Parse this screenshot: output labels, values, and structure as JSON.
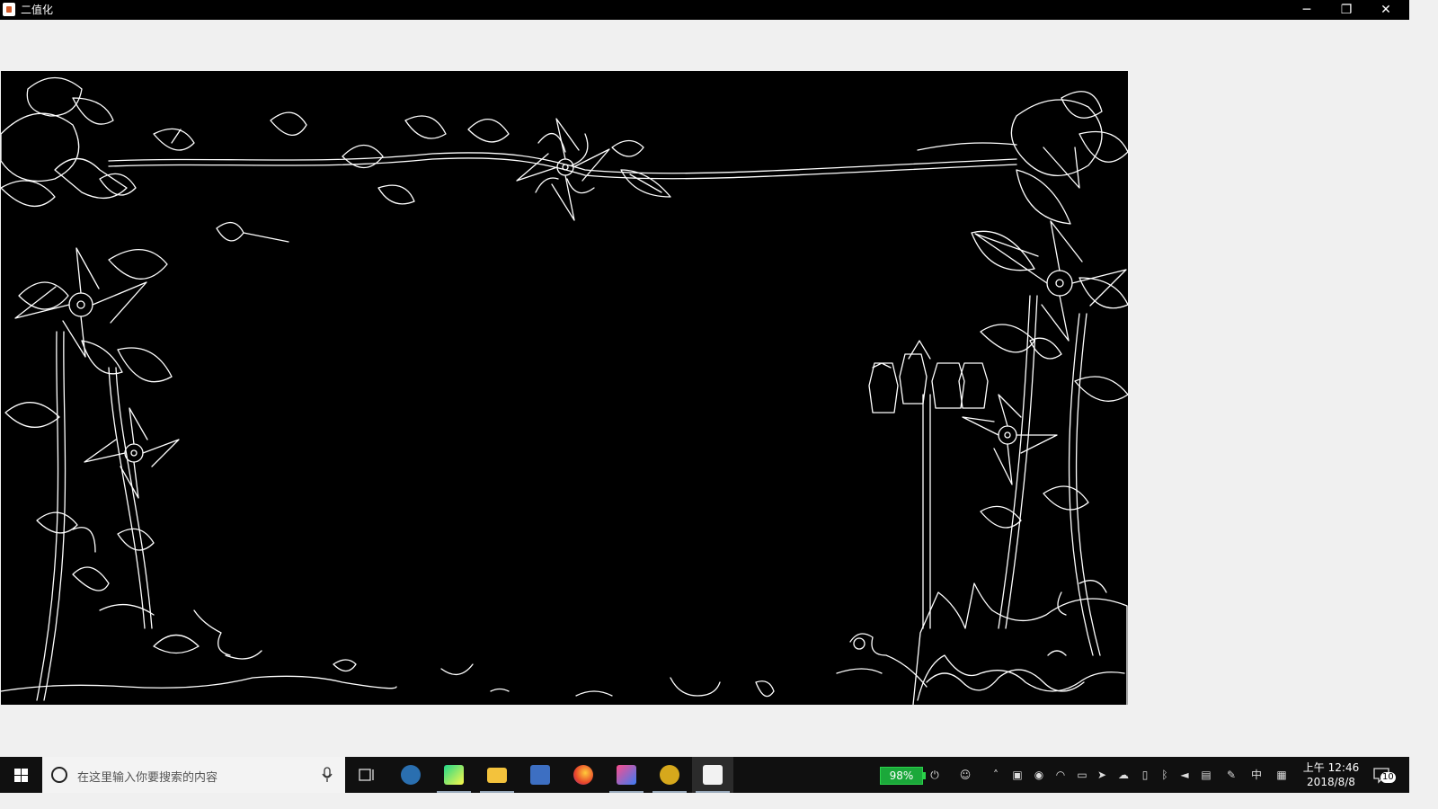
{
  "window": {
    "title": "二值化",
    "minimize_glyph": "─",
    "maximize_glyph": "❐",
    "close_glyph": "✕"
  },
  "canvas": {
    "image_kind": "binarized edge image",
    "background": "#000000",
    "line_color": "#ffffff"
  },
  "taskbar": {
    "search_placeholder": "在这里输入你要搜索的内容",
    "pinned": [
      {
        "name": "task-view-icon"
      },
      {
        "name": "media-app-icon"
      },
      {
        "name": "pycharm-icon"
      },
      {
        "name": "file-explorer-icon"
      },
      {
        "name": "remote-desktop-icon"
      },
      {
        "name": "firefox-icon"
      },
      {
        "name": "intellij-icon"
      },
      {
        "name": "ultraedit-icon"
      },
      {
        "name": "java-app-icon"
      }
    ],
    "battery_percent": "98%",
    "ime_label": "中",
    "clock_period": "上午",
    "clock_time": "12:46",
    "clock_date": "2018/8/8",
    "notification_count": "10"
  }
}
